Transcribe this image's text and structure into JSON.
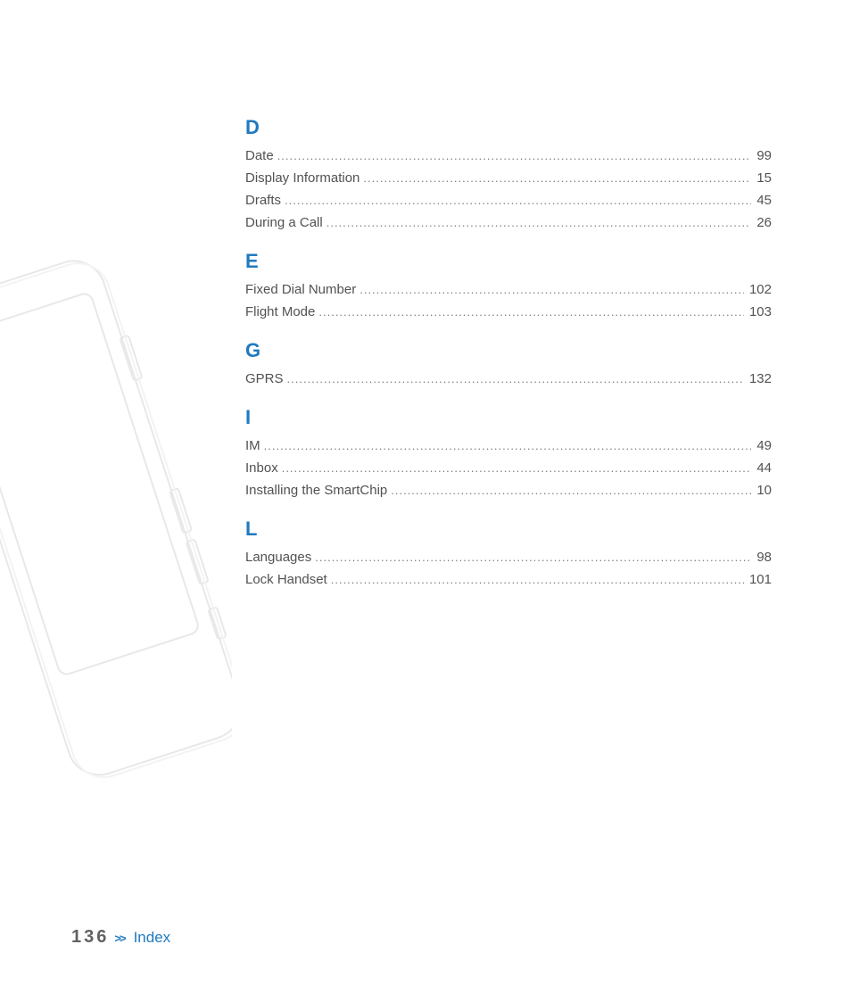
{
  "footer": {
    "page_number": "136",
    "chevron": ">>",
    "title": "Index"
  },
  "sections": {
    "D": [
      {
        "label": "Date",
        "page": "99"
      },
      {
        "label": "Display Information",
        "page": "15"
      },
      {
        "label": "Drafts",
        "page": "45"
      },
      {
        "label": "During a Call",
        "page": "26"
      }
    ],
    "E": [
      {
        "label": "Fixed Dial Number",
        "page": "102"
      },
      {
        "label": "Flight Mode",
        "page": "103"
      }
    ],
    "G": [
      {
        "label": "GPRS",
        "page": "132"
      }
    ],
    "I": [
      {
        "label": "IM",
        "page": "49"
      },
      {
        "label": "Inbox",
        "page": "44"
      },
      {
        "label": "Installing the SmartChip",
        "page": "10"
      }
    ],
    "L": [
      {
        "label": "Languages",
        "page": "98"
      },
      {
        "label": "Lock Handset",
        "page": "101"
      }
    ]
  },
  "letters": {
    "D": "D",
    "E": "E",
    "G": "G",
    "I": "I",
    "L": "L"
  }
}
